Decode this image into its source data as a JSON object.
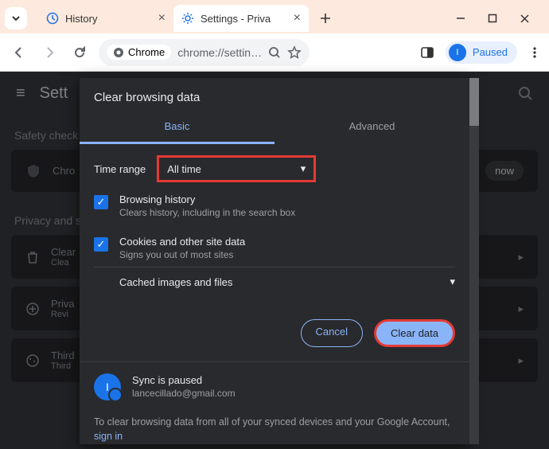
{
  "tabs": [
    {
      "label": "History"
    },
    {
      "label": "Settings - Priva"
    }
  ],
  "toolbar": {
    "chrome_chip": "Chrome",
    "url": "chrome://settin…",
    "paused": "Paused",
    "avatar_initial": "I"
  },
  "page": {
    "title": "Sett",
    "safety_label": "Safety check",
    "chrome_card": "Chro",
    "check_now": "now",
    "privacy_label": "Privacy and s",
    "items": [
      {
        "t": "Clear",
        "s": "Clea"
      },
      {
        "t": "Priva",
        "s": "Revi"
      },
      {
        "t": "Third",
        "s": "Third"
      }
    ]
  },
  "modal": {
    "title": "Clear browsing data",
    "tab_basic": "Basic",
    "tab_advanced": "Advanced",
    "range_label": "Time range",
    "range_value": "All time",
    "opts": [
      {
        "t": "Browsing history",
        "s": "Clears history, including in the search box"
      },
      {
        "t": "Cookies and other site data",
        "s": "Signs you out of most sites"
      }
    ],
    "cached_label": "Cached images and files",
    "cancel": "Cancel",
    "clear": "Clear data",
    "sync_title": "Sync is paused",
    "sync_email": "lancecillado@gmail.com",
    "avatar_initial": "I",
    "note_a": "To clear browsing data from all of your synced devices and your Google Account, ",
    "note_link": "sign in"
  }
}
